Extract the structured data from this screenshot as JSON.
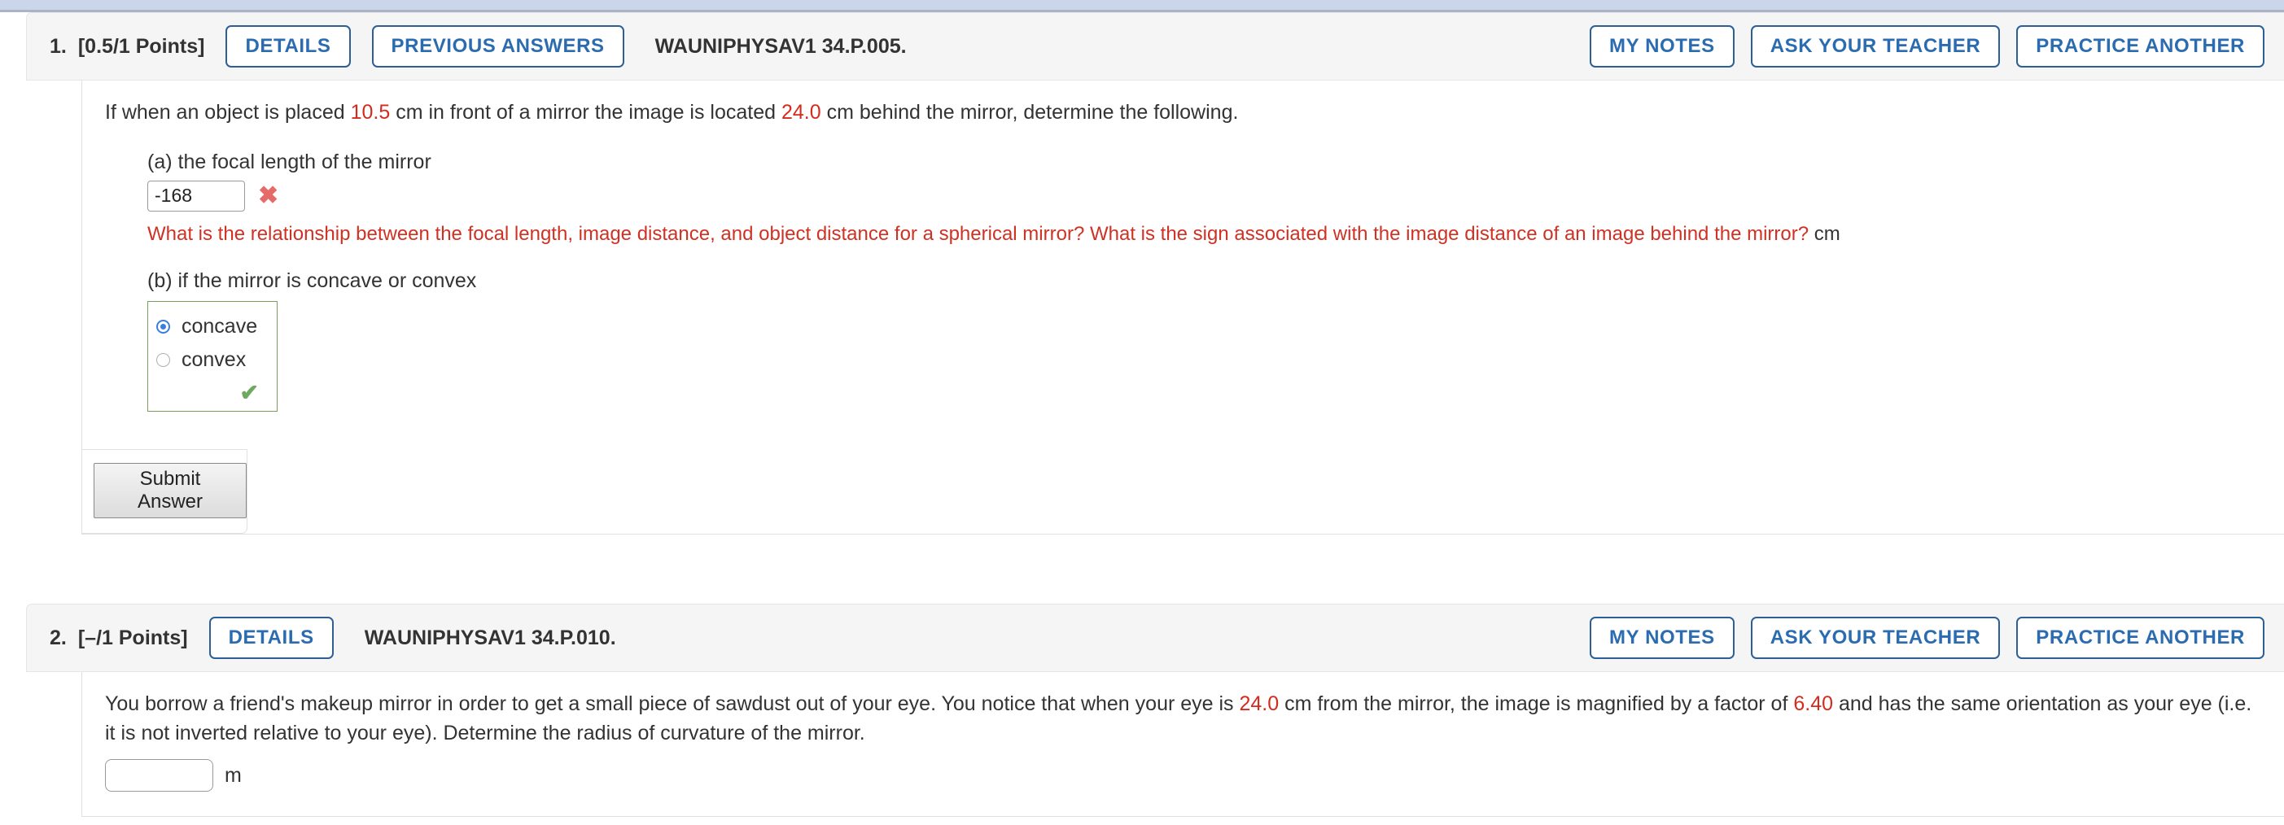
{
  "page": {
    "accent_blue": "#2b6cb0",
    "border_blue": "#2b5f96",
    "red": "#d42b1e",
    "feedback_red": "#cf3224",
    "green": "#6fa960",
    "green_border": "#7ba05b",
    "header_bg": "#f5f5f5",
    "top_band": "#ccd6ea"
  },
  "questions": [
    {
      "number": "1.",
      "points": "[0.5/1 Points]",
      "code": "WAUNIPHYSAV1 34.P.005.",
      "details_label": "DETAILS",
      "previous_answers_label": "PREVIOUS ANSWERS",
      "my_notes_label": "MY NOTES",
      "ask_teacher_label": "ASK YOUR TEACHER",
      "practice_another_label": "PRACTICE ANOTHER",
      "prompt": {
        "part1": "If when an object is placed ",
        "value1": "10.5",
        "part2": " cm in front of a mirror the image is located ",
        "value2": "24.0",
        "part3": " cm behind the mirror, determine the following."
      },
      "part_a": {
        "label": "(a) the focal length of the mirror",
        "input_value": "-168",
        "mark": "incorrect-x",
        "feedback": "What is the relationship between the focal length, image distance, and object distance for a spherical mirror? What is the sign associated with the image distance of an image behind the mirror?",
        "unit": "cm"
      },
      "part_b": {
        "label": "(b) if the mirror is concave or convex",
        "options": [
          {
            "label": "concave",
            "selected": true
          },
          {
            "label": "convex",
            "selected": false
          }
        ],
        "mark": "correct-check"
      },
      "submit_label": "Submit Answer"
    },
    {
      "number": "2.",
      "points": "[–/1 Points]",
      "code": "WAUNIPHYSAV1 34.P.010.",
      "details_label": "DETAILS",
      "my_notes_label": "MY NOTES",
      "ask_teacher_label": "ASK YOUR TEACHER",
      "practice_another_label": "PRACTICE ANOTHER",
      "prompt": {
        "part1": "You borrow a friend's makeup mirror in order to get a small piece of sawdust out of your eye. You notice that when your eye is ",
        "value1": "24.0",
        "part2": " cm from the mirror, the image is magnified by a factor of ",
        "value2": "6.40",
        "part3": " and has the same orientation as your eye (i.e. it is not inverted relative to your eye). Determine the radius of curvature of the mirror."
      },
      "answer": {
        "input_value": "",
        "unit": "m"
      }
    }
  ]
}
